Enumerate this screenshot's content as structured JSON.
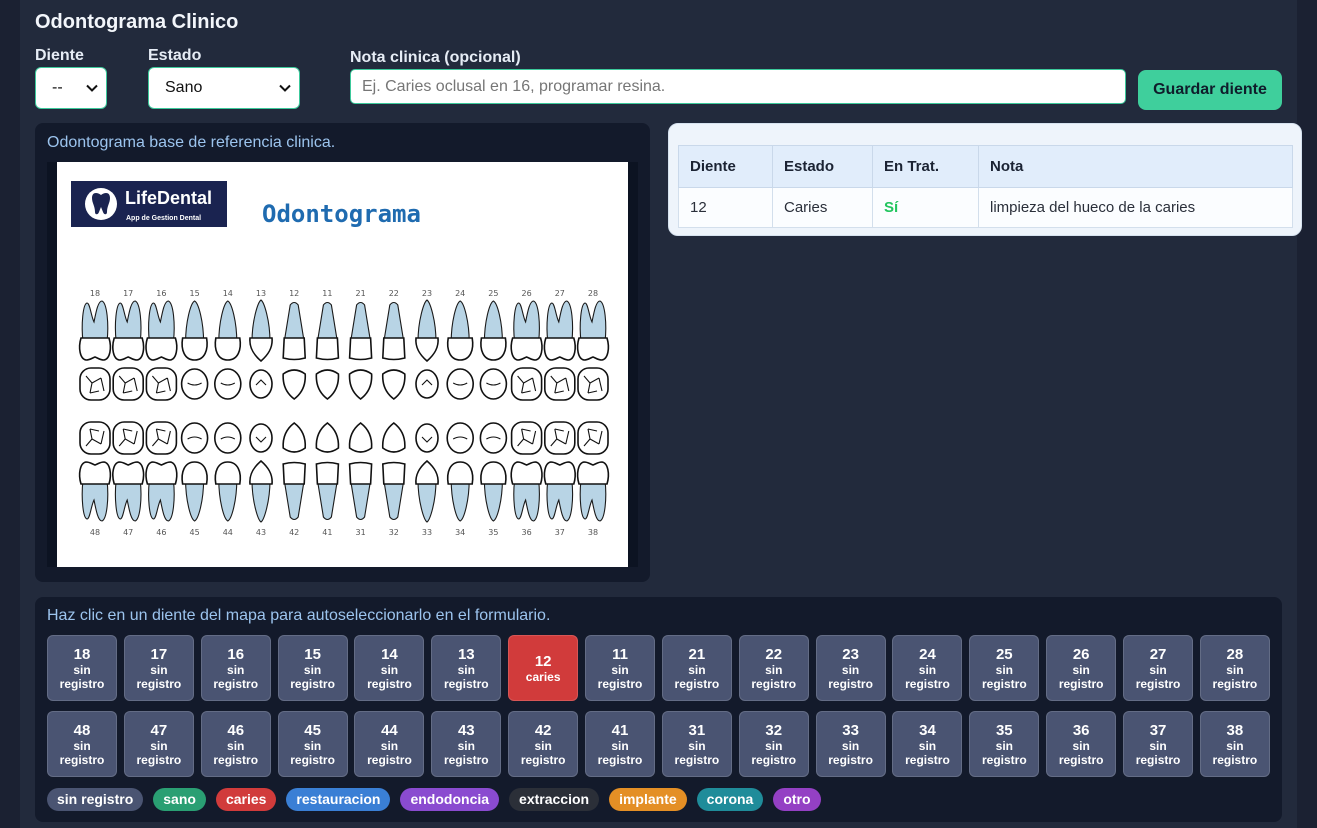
{
  "app": {
    "title": "Odontograma Clinico"
  },
  "form": {
    "diente": {
      "label": "Diente",
      "value": "--"
    },
    "estado": {
      "label": "Estado",
      "value": "Sano"
    },
    "nota": {
      "label": "Nota clinica (opcional)",
      "placeholder": "Ej. Caries oclusal en 16, programar resina.",
      "value": ""
    },
    "save_label": "Guardar diente"
  },
  "reference": {
    "caption": "Odontograma base de referencia clinica.",
    "logo": {
      "name": "LifeDental",
      "tagline": "App de Gestion Dental"
    },
    "heading": "Odontograma",
    "upper_numbers": [
      "18",
      "17",
      "16",
      "15",
      "14",
      "13",
      "12",
      "11",
      "21",
      "22",
      "23",
      "24",
      "25",
      "26",
      "27",
      "28"
    ],
    "lower_numbers": [
      "48",
      "47",
      "46",
      "45",
      "44",
      "43",
      "42",
      "41",
      "31",
      "32",
      "33",
      "34",
      "35",
      "36",
      "37",
      "38"
    ]
  },
  "table": {
    "headers": [
      "Diente",
      "Estado",
      "En Trat.",
      "Nota"
    ],
    "rows": [
      {
        "diente": "12",
        "estado": "Caries",
        "en_trat": "Sí",
        "nota": "limpieza del hueco de la caries"
      }
    ]
  },
  "map": {
    "caption": "Haz clic en un diente del mapa para autoseleccionarlo en el formulario.",
    "rows": [
      [
        {
          "number": "18",
          "status": "sin registro"
        },
        {
          "number": "17",
          "status": "sin registro"
        },
        {
          "number": "16",
          "status": "sin registro"
        },
        {
          "number": "15",
          "status": "sin registro"
        },
        {
          "number": "14",
          "status": "sin registro"
        },
        {
          "number": "13",
          "status": "sin registro"
        },
        {
          "number": "12",
          "status": "caries"
        },
        {
          "number": "11",
          "status": "sin registro"
        },
        {
          "number": "21",
          "status": "sin registro"
        },
        {
          "number": "22",
          "status": "sin registro"
        },
        {
          "number": "23",
          "status": "sin registro"
        },
        {
          "number": "24",
          "status": "sin registro"
        },
        {
          "number": "25",
          "status": "sin registro"
        },
        {
          "number": "26",
          "status": "sin registro"
        },
        {
          "number": "27",
          "status": "sin registro"
        },
        {
          "number": "28",
          "status": "sin registro"
        }
      ],
      [
        {
          "number": "48",
          "status": "sin registro"
        },
        {
          "number": "47",
          "status": "sin registro"
        },
        {
          "number": "46",
          "status": "sin registro"
        },
        {
          "number": "45",
          "status": "sin registro"
        },
        {
          "number": "44",
          "status": "sin registro"
        },
        {
          "number": "43",
          "status": "sin registro"
        },
        {
          "number": "42",
          "status": "sin registro"
        },
        {
          "number": "41",
          "status": "sin registro"
        },
        {
          "number": "31",
          "status": "sin registro"
        },
        {
          "number": "32",
          "status": "sin registro"
        },
        {
          "number": "33",
          "status": "sin registro"
        },
        {
          "number": "34",
          "status": "sin registro"
        },
        {
          "number": "35",
          "status": "sin registro"
        },
        {
          "number": "36",
          "status": "sin registro"
        },
        {
          "number": "37",
          "status": "sin registro"
        },
        {
          "number": "38",
          "status": "sin registro"
        }
      ]
    ]
  },
  "legend": [
    {
      "label": "sin registro",
      "color": "#4a5472"
    },
    {
      "label": "sano",
      "color": "#2a9f73"
    },
    {
      "label": "caries",
      "color": "#d13b3b"
    },
    {
      "label": "restauracion",
      "color": "#3a7fd5"
    },
    {
      "label": "endodoncia",
      "color": "#8a4bd0"
    },
    {
      "label": "extraccion",
      "color": "#2b2f38"
    },
    {
      "label": "implante",
      "color": "#e48f25"
    },
    {
      "label": "corona",
      "color": "#1f8c9a"
    },
    {
      "label": "otro",
      "color": "#9440c4"
    }
  ],
  "colors": {
    "accent": "#3fcf9c",
    "positive": "#22c55e",
    "logo_bg": "#1a2350",
    "heading": "#1f6bb0"
  },
  "icons": {
    "select_chevron": "chevron-down-icon",
    "logo_mark": "tooth-icon"
  }
}
